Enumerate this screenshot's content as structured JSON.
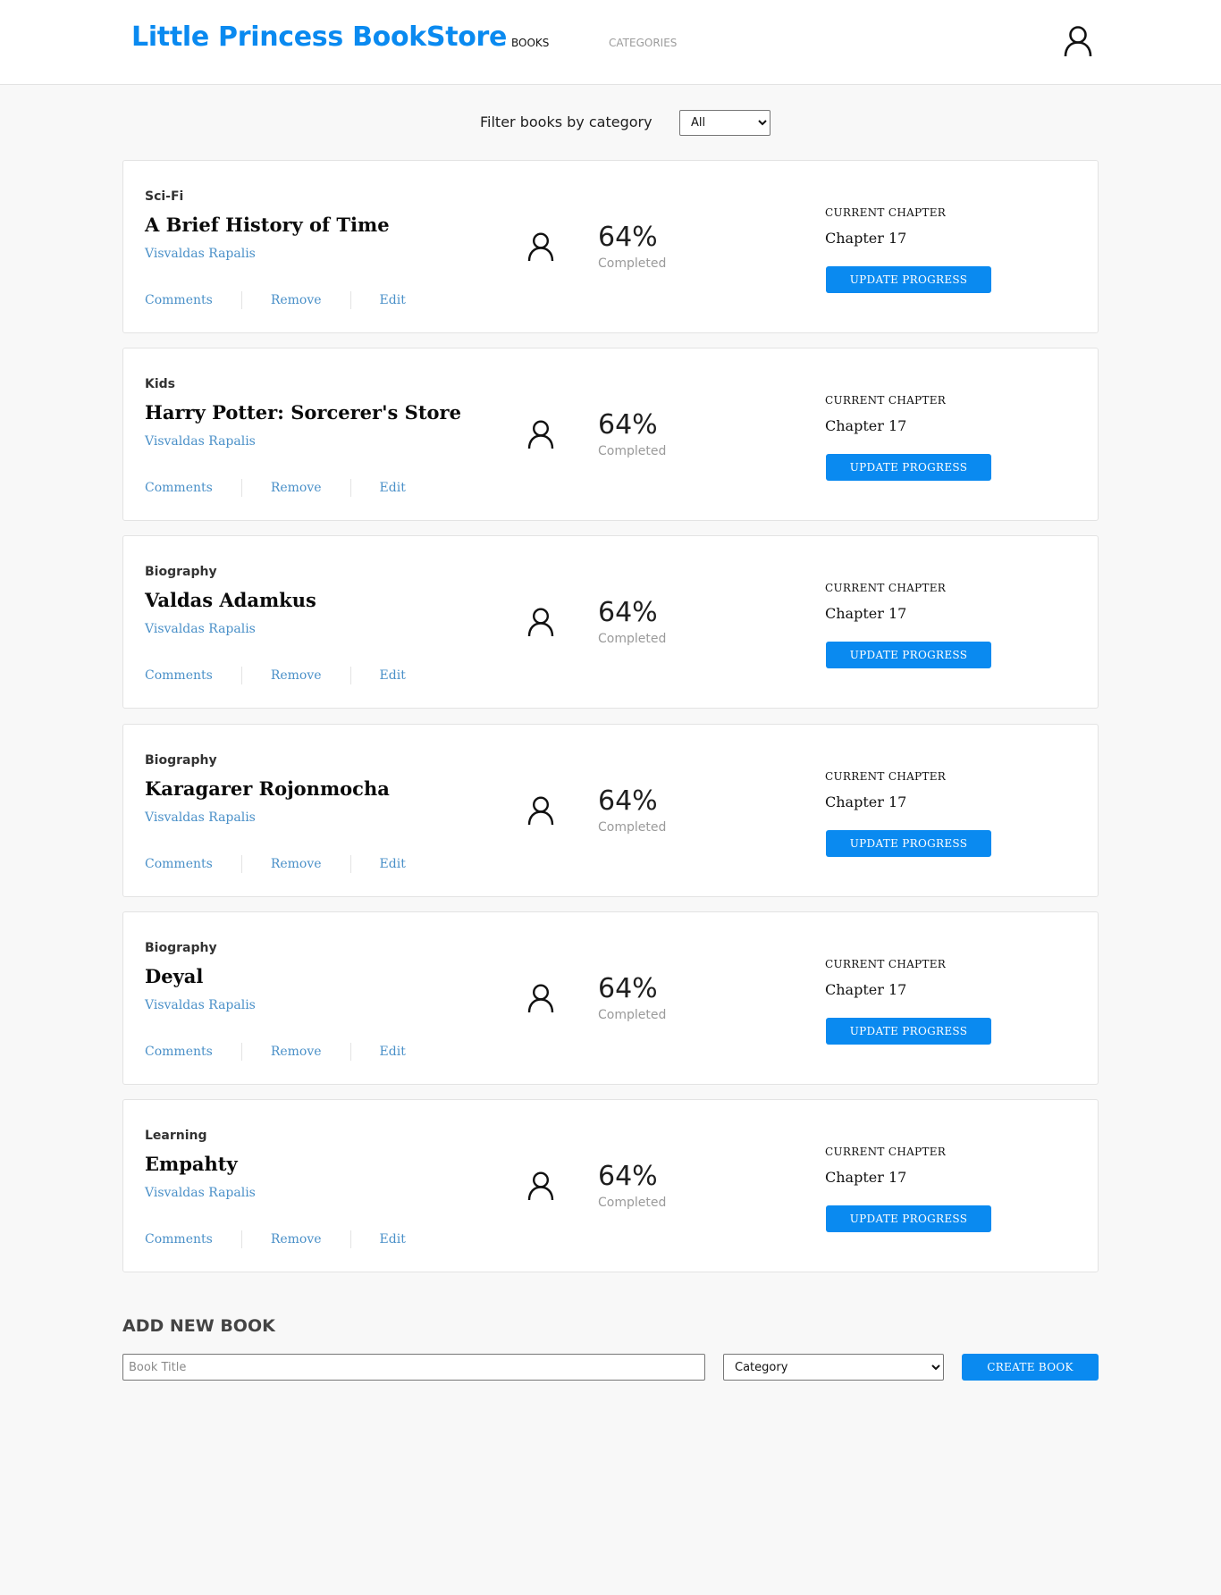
{
  "header": {
    "brand": "Little Princess BookStore",
    "nav": [
      {
        "label": "BOOKS"
      },
      {
        "label": "CATEGORIES"
      }
    ],
    "user_icon": "user-icon"
  },
  "filter": {
    "label": "Filter books by category",
    "selected": "All"
  },
  "books": [
    {
      "category": "Sci-Fi",
      "title": "A Brief History of Time",
      "author": "Visvaldas Rapalis",
      "progress": "64%",
      "progress_value": 64,
      "completed_label": "Completed",
      "chapter_label": "CURRENT CHAPTER",
      "chapter": "Chapter 17",
      "update_label": "UPDATE PROGRESS",
      "actions": {
        "comments": "Comments",
        "remove": "Remove",
        "edit": "Edit"
      }
    },
    {
      "category": "Kids",
      "title": "Harry Potter: Sorcerer's Store",
      "author": "Visvaldas Rapalis",
      "progress": "64%",
      "progress_value": 64,
      "completed_label": "Completed",
      "chapter_label": "CURRENT CHAPTER",
      "chapter": "Chapter 17",
      "update_label": "UPDATE PROGRESS",
      "actions": {
        "comments": "Comments",
        "remove": "Remove",
        "edit": "Edit"
      }
    },
    {
      "category": "Biography",
      "title": "Valdas Adamkus",
      "author": "Visvaldas Rapalis",
      "progress": "64%",
      "progress_value": 64,
      "completed_label": "Completed",
      "chapter_label": "CURRENT CHAPTER",
      "chapter": "Chapter 17",
      "update_label": "UPDATE PROGRESS",
      "actions": {
        "comments": "Comments",
        "remove": "Remove",
        "edit": "Edit"
      }
    },
    {
      "category": "Biography",
      "title": "Karagarer Rojonmocha",
      "author": "Visvaldas Rapalis",
      "progress": "64%",
      "progress_value": 64,
      "completed_label": "Completed",
      "chapter_label": "CURRENT CHAPTER",
      "chapter": "Chapter 17",
      "update_label": "UPDATE PROGRESS",
      "actions": {
        "comments": "Comments",
        "remove": "Remove",
        "edit": "Edit"
      }
    },
    {
      "category": "Biography",
      "title": "Deyal",
      "author": "Visvaldas Rapalis",
      "progress": "64%",
      "progress_value": 64,
      "completed_label": "Completed",
      "chapter_label": "CURRENT CHAPTER",
      "chapter": "Chapter 17",
      "update_label": "UPDATE PROGRESS",
      "actions": {
        "comments": "Comments",
        "remove": "Remove",
        "edit": "Edit"
      }
    },
    {
      "category": "Learning",
      "title": "Empahty",
      "author": "Visvaldas Rapalis",
      "progress": "64%",
      "progress_value": 64,
      "completed_label": "Completed",
      "chapter_label": "CURRENT CHAPTER",
      "chapter": "Chapter 17",
      "update_label": "UPDATE PROGRESS",
      "actions": {
        "comments": "Comments",
        "remove": "Remove",
        "edit": "Edit"
      }
    }
  ],
  "add_book": {
    "heading": "ADD NEW BOOK",
    "title_placeholder": "Book Title",
    "category_placeholder": "Category",
    "create_label": "CREATE BOOK"
  },
  "colors": {
    "accent": "#0a8af0",
    "link": "#4a90c8",
    "background": "#f8f8f8",
    "card": "#ffffff",
    "border": "#e3e3e3"
  }
}
